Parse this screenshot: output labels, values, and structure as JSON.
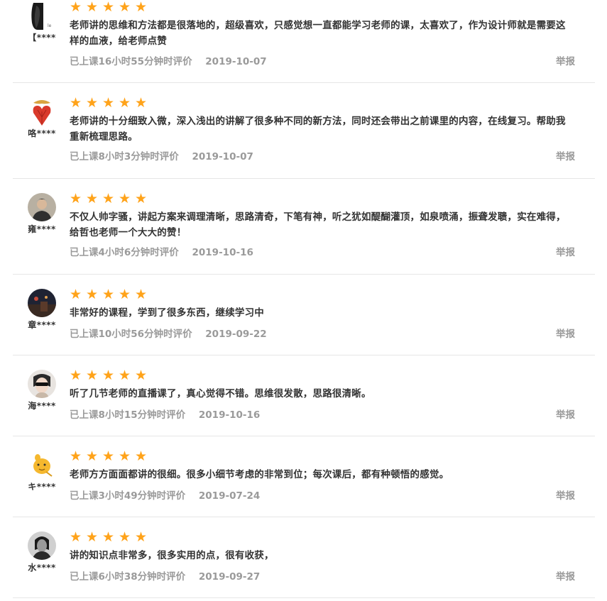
{
  "colors": {
    "star": "#ffa31a",
    "meta": "#9a9a9a",
    "text": "#333333",
    "divider": "#e6e6e6"
  },
  "reviews": [
    {
      "username": "【****",
      "avatar": "avatar-photo-dark",
      "stars": 5,
      "text": "老师讲的思维和方法都是很落地的，超级喜欢，只感觉想一直都能学习老师的课，太喜欢了，作为设计师就是需要这样的血液，给老师点赞",
      "duration": "已上课16小时55分钟时评价",
      "date": "2019-10-07",
      "report": "举报"
    },
    {
      "username": "咯****",
      "avatar": "avatar-red-heart",
      "stars": 5,
      "text": "老师讲的十分细致入微，深入浅出的讲解了很多种不同的新方法，同时还会带出之前课里的内容，在线复习。帮助我重新梳理思路。",
      "duration": "已上课8小时3分钟时评价",
      "date": "2019-10-07",
      "report": "举报"
    },
    {
      "username": "雍****",
      "avatar": "avatar-photo-man",
      "stars": 5,
      "text": "不仅人帅字骚，讲起方案来调理清晰，思路清奇，下笔有神，听之犹如醍醐灌顶，如泉喷涌，振聋发聩，实在难得，给哲也老师一个大大的赞！",
      "duration": "已上课4小时6分钟时评价",
      "date": "2019-10-16",
      "report": "举报"
    },
    {
      "username": "章****",
      "avatar": "avatar-photo-night",
      "stars": 5,
      "text": "非常好的课程，学到了很多东西，继续学习中",
      "duration": "已上课10小时56分钟时评价",
      "date": "2019-09-22",
      "report": "举报"
    },
    {
      "username": "海****",
      "avatar": "avatar-photo-sunglasses",
      "stars": 5,
      "text": "听了几节老师的直播课了，真心觉得不错。思维很发散，思路很清晰。",
      "duration": "已上课8小时15分钟时评价",
      "date": "2019-10-16",
      "report": "举报"
    },
    {
      "username": "キ****",
      "avatar": "avatar-cartoon-yellow",
      "stars": 5,
      "text": "老师方方面面都讲的很细。很多小细节考虑的非常到位；每次课后，都有种顿悟的感觉。",
      "duration": "已上课3小时49分钟时评价",
      "date": "2019-07-24",
      "report": "举报"
    },
    {
      "username": "水****",
      "avatar": "avatar-photo-bw",
      "stars": 5,
      "text": "讲的知识点非常多，很多实用的点，很有收获，",
      "duration": "已上课6小时38分钟时评价",
      "date": "2019-09-27",
      "report": "举报"
    }
  ]
}
